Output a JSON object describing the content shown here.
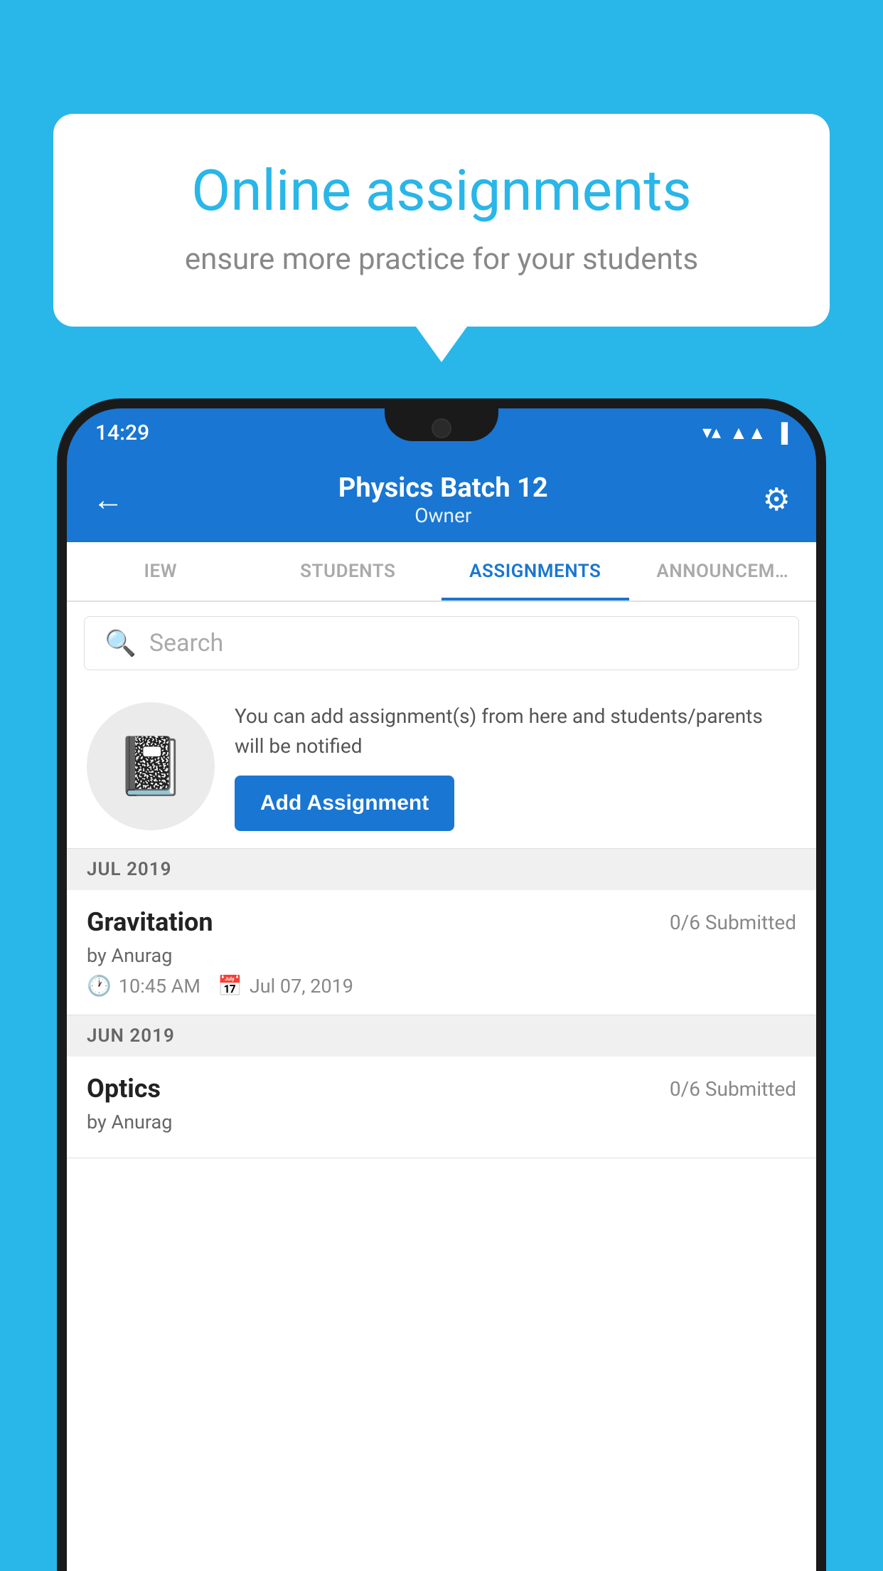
{
  "background_color": "#29b6e8",
  "speech_bubble": {
    "title": "Online assignments",
    "subtitle": "ensure more practice for your students"
  },
  "status_bar": {
    "time": "14:29",
    "wifi": "▼▲",
    "signal": "▲▲",
    "battery": "█"
  },
  "header": {
    "title": "Physics Batch 12",
    "subtitle": "Owner",
    "back_label": "←",
    "gear_label": "⚙"
  },
  "tabs": [
    {
      "label": "IEW",
      "active": false
    },
    {
      "label": "STUDENTS",
      "active": false
    },
    {
      "label": "ASSIGNMENTS",
      "active": true
    },
    {
      "label": "ANNOUNCEM…",
      "active": false
    }
  ],
  "search": {
    "placeholder": "Search"
  },
  "promo": {
    "description": "You can add assignment(s) from here and students/parents will be notified",
    "button_label": "Add Assignment"
  },
  "sections": [
    {
      "label": "JUL 2019",
      "assignments": [
        {
          "name": "Gravitation",
          "submitted": "0/6 Submitted",
          "by": "by Anurag",
          "time": "10:45 AM",
          "date": "Jul 07, 2019"
        }
      ]
    },
    {
      "label": "JUN 2019",
      "assignments": [
        {
          "name": "Optics",
          "submitted": "0/6 Submitted",
          "by": "by Anurag",
          "time": "",
          "date": ""
        }
      ]
    }
  ]
}
